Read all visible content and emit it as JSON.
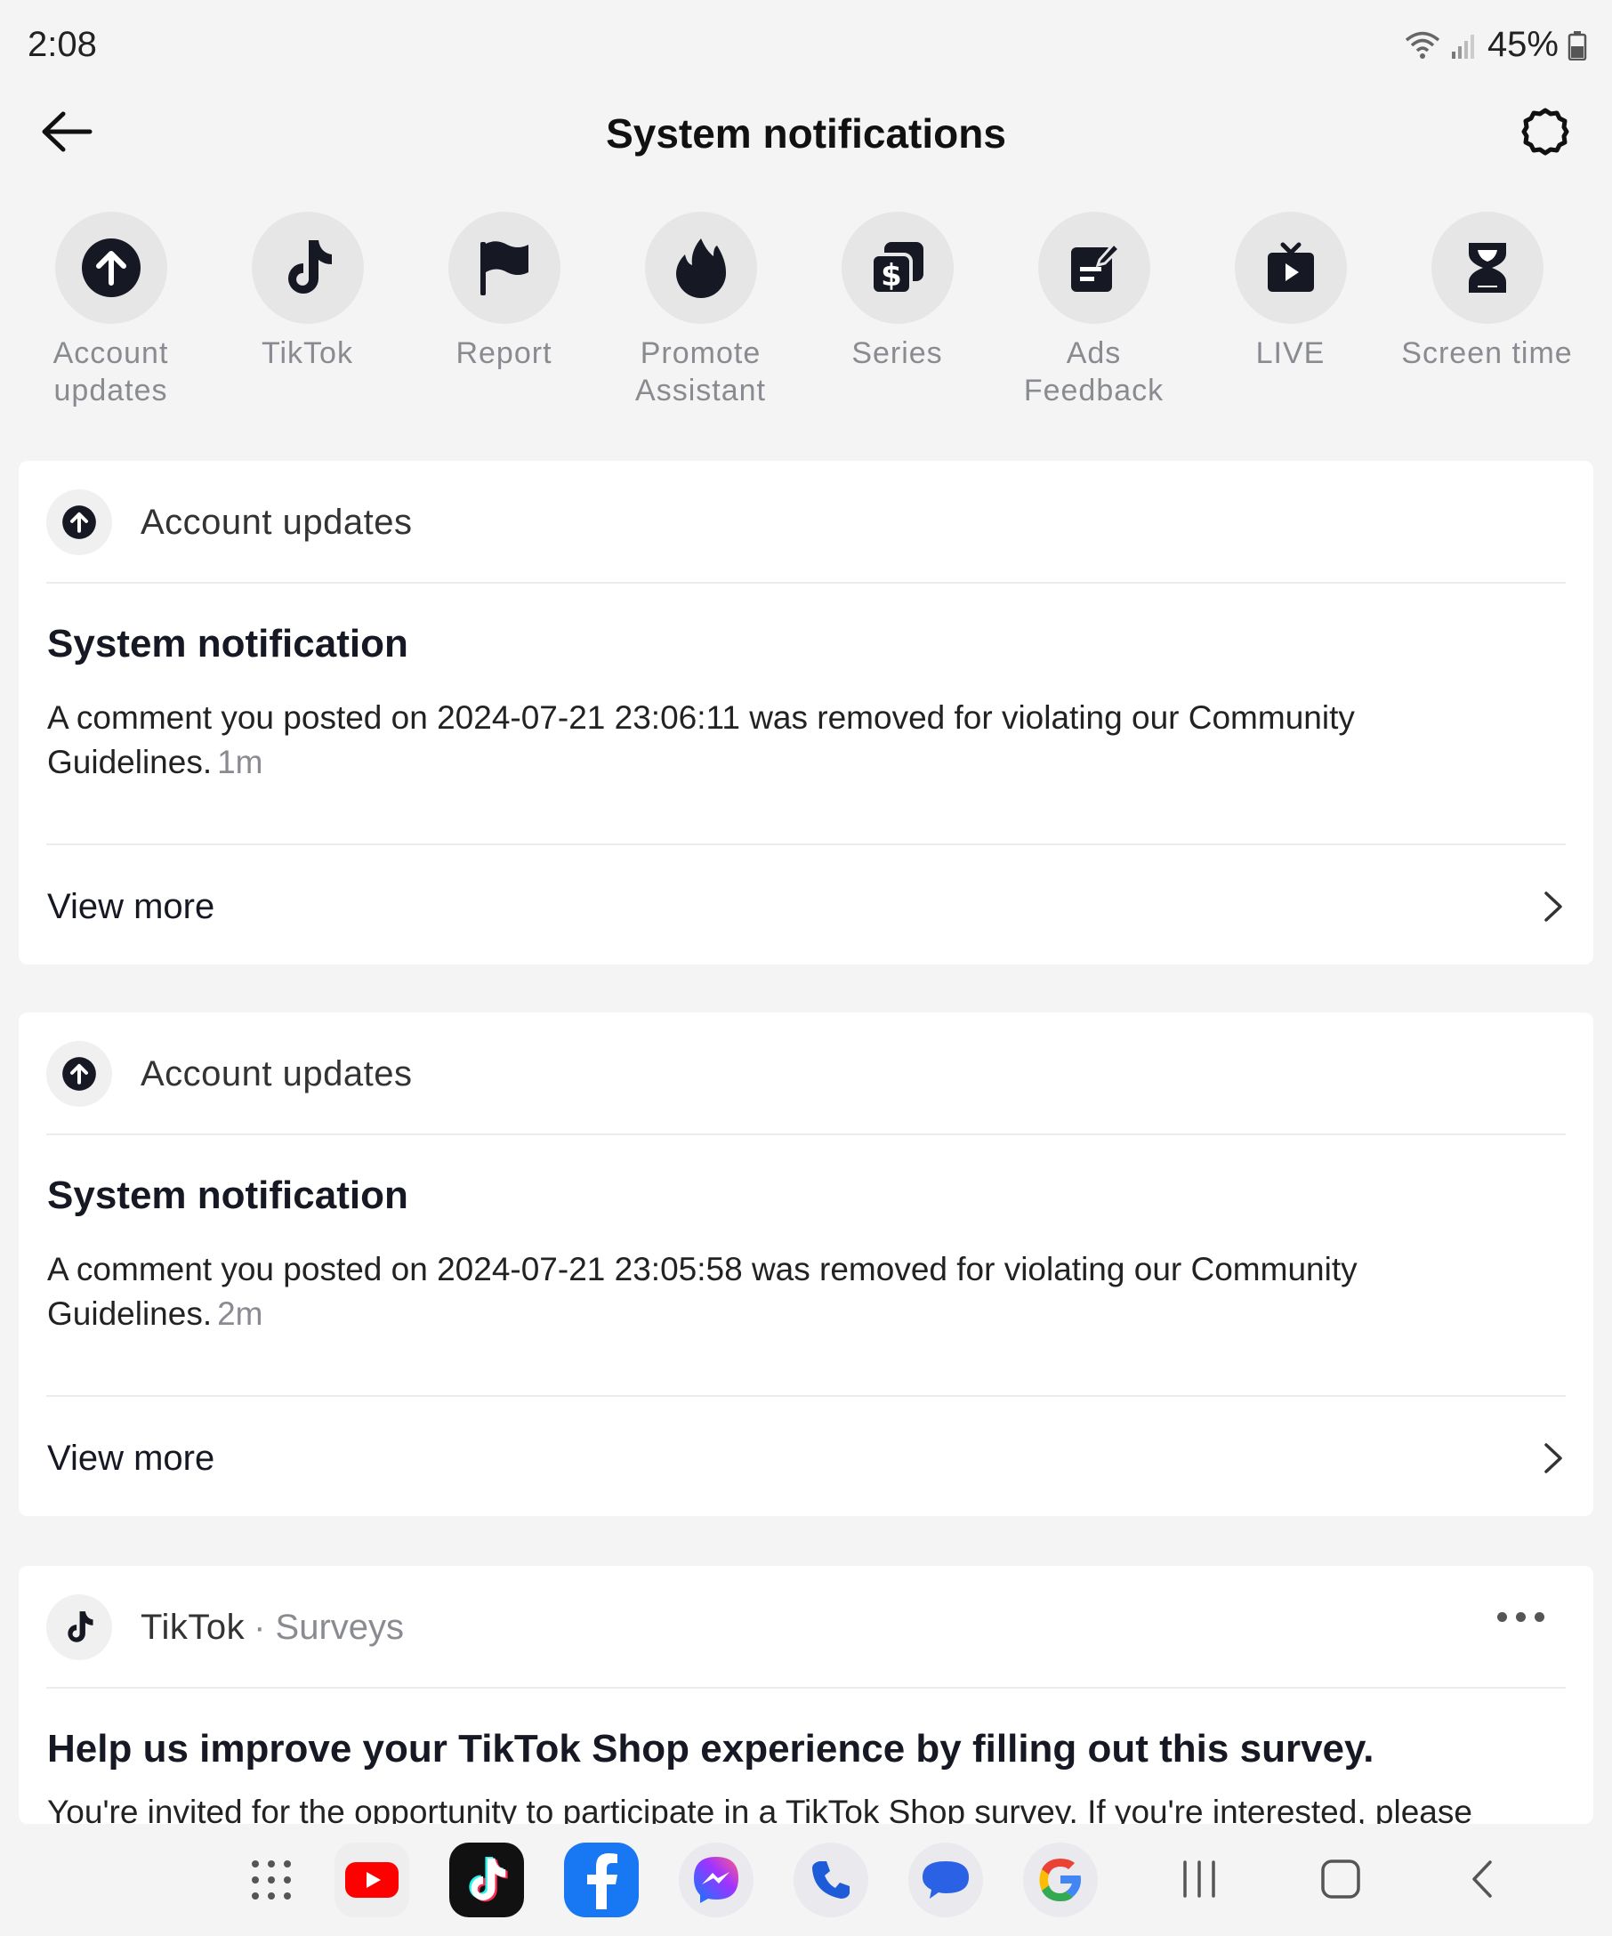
{
  "status_bar": {
    "time": "2:08",
    "battery": "45%"
  },
  "header": {
    "title": "System notifications"
  },
  "categories": [
    {
      "label": "Account updates",
      "icon": "arrow-up-circle-icon"
    },
    {
      "label": "TikTok",
      "icon": "tiktok-note-icon"
    },
    {
      "label": "Report",
      "icon": "flag-icon"
    },
    {
      "label": "Promote Assistant",
      "icon": "flame-icon"
    },
    {
      "label": "Series",
      "icon": "dollar-stack-icon"
    },
    {
      "label": "Ads Feedback",
      "icon": "edit-note-icon"
    },
    {
      "label": "LIVE",
      "icon": "tv-play-icon"
    },
    {
      "label": "Screen time",
      "icon": "hourglass-icon"
    }
  ],
  "cards": [
    {
      "source": "Account updates",
      "title": "System notification",
      "body": "A comment you posted on 2024-07-21 23:06:11 was removed for violating our Community Guidelines.",
      "time": "1m",
      "action": "View more"
    },
    {
      "source": "Account updates",
      "title": "System notification",
      "body": "A comment you posted on 2024-07-21 23:05:58 was removed for violating our Community Guidelines.",
      "time": "2m",
      "action": "View more"
    },
    {
      "source": "TikTok",
      "source_sub": "· Surveys",
      "title": "Help us improve your TikTok Shop experience by filling out this survey.",
      "body": "You're invited for the opportunity to participate in a TikTok Shop survey. If you're interested, please"
    }
  ],
  "dock": {
    "apps": [
      "app-drawer",
      "youtube",
      "tiktok",
      "facebook",
      "messenger",
      "phone",
      "messages",
      "google"
    ],
    "nav": [
      "recents",
      "home",
      "back"
    ]
  },
  "colors": {
    "background": "#f4f4f4",
    "card": "#ffffff",
    "text_primary": "#161823",
    "text_secondary": "#8a8b91"
  }
}
